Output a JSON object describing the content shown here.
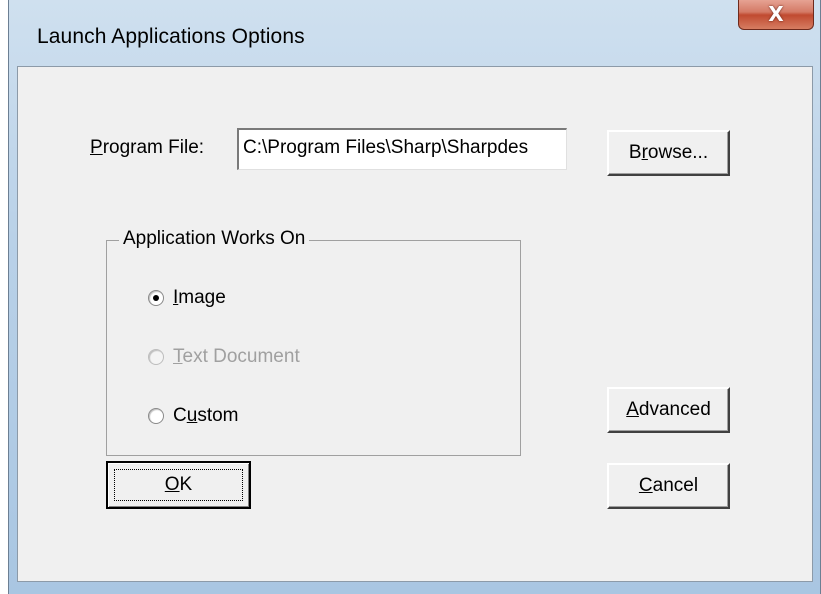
{
  "window": {
    "title": "Launch Applications Options",
    "close_glyph": "X",
    "close_icon": "close-icon"
  },
  "program_file": {
    "label_mnemonic": "P",
    "label_rest": "rogram File:",
    "value": "C:\\Program Files\\Sharp\\Sharpdes"
  },
  "buttons": {
    "browse": {
      "pre": "B",
      "mnemonic": "r",
      "post": "owse..."
    },
    "advanced": {
      "mnemonic": "A",
      "post": "dvanced"
    },
    "ok": {
      "mnemonic": "O",
      "post": "K"
    },
    "cancel": {
      "mnemonic": "C",
      "post": "ancel"
    }
  },
  "group": {
    "title": "Application Works On",
    "options": [
      {
        "mnemonic": "I",
        "rest": "mage",
        "checked": true,
        "enabled": true
      },
      {
        "mnemonic": "T",
        "rest": "ext Document",
        "checked": false,
        "enabled": false
      },
      {
        "pre": "C",
        "mnemonic": "u",
        "rest": "stom",
        "checked": false,
        "enabled": true
      }
    ]
  },
  "colors": {
    "dialog_bg": "#f0f0f0",
    "frame_accent": "#b9d1e8",
    "close_red": "#c04a30",
    "disabled_text": "#a0a0a0"
  }
}
